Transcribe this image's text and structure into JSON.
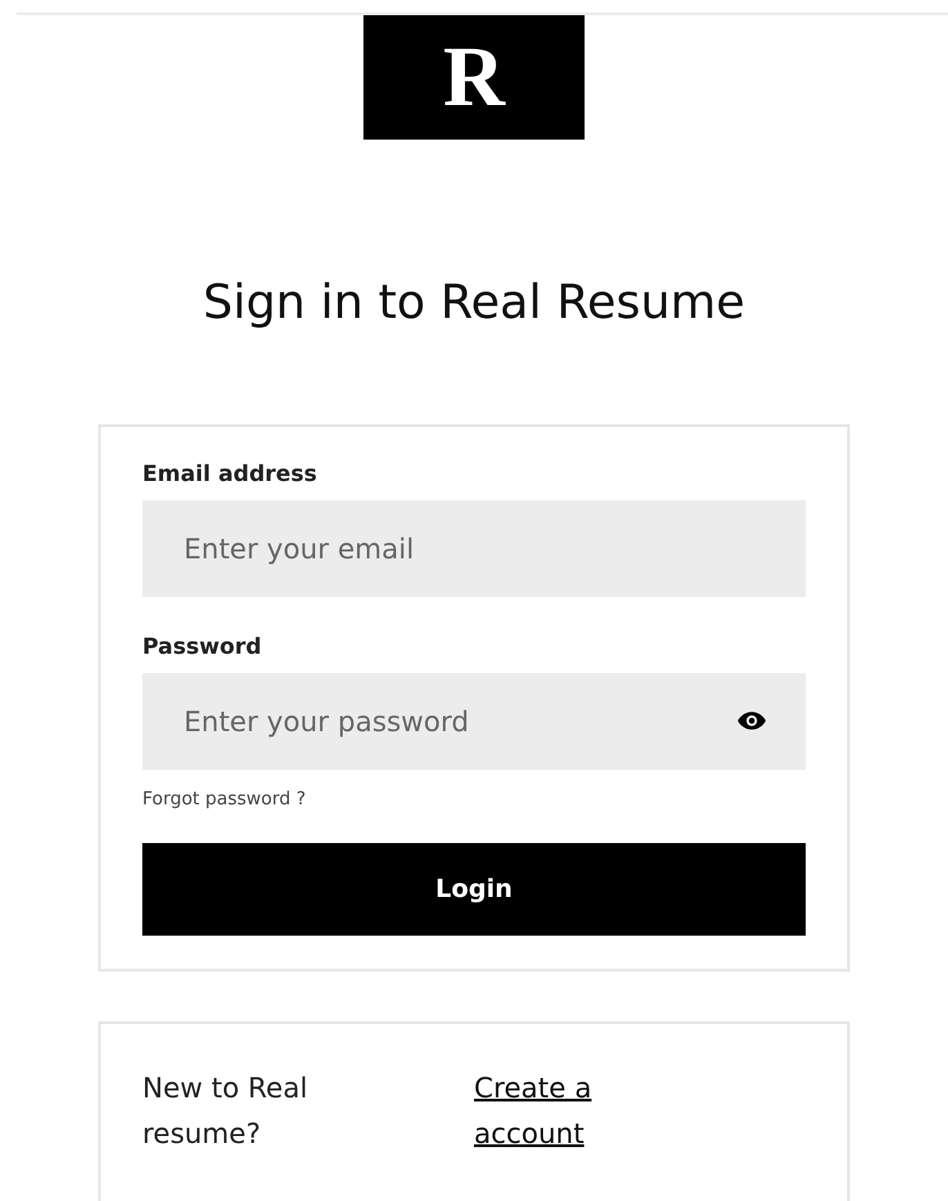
{
  "logo": {
    "letter": "R"
  },
  "title": "Sign in to Real Resume",
  "login_form": {
    "fields": [
      {
        "label": "Email address",
        "placeholder": "Enter your email",
        "kind": "text"
      },
      {
        "label": "Password",
        "placeholder": "Enter your password",
        "kind": "password"
      }
    ],
    "forgot_link": "Forgot password ?",
    "button": "Login"
  },
  "signup": {
    "prompt": "New to Real resume?",
    "link": "Create a account"
  }
}
